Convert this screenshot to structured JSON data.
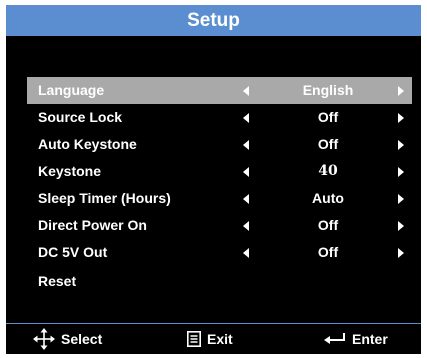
{
  "title": "Setup",
  "menu": [
    {
      "label": "Language",
      "value": "English",
      "selected": true
    },
    {
      "label": "Source Lock",
      "value": "Off"
    },
    {
      "label": "Auto Keystone",
      "value": "Off"
    },
    {
      "label": "Keystone",
      "value": "40"
    },
    {
      "label": "Sleep Timer (Hours)",
      "value": "Auto"
    },
    {
      "label": "Direct Power On",
      "value": "Off"
    },
    {
      "label": "DC 5V Out",
      "value": "Off"
    },
    {
      "label": "Reset",
      "value": ""
    }
  ],
  "footer": {
    "select": {
      "label": "Select",
      "icon": "four-way-arrows-icon"
    },
    "exit": {
      "label": "Exit",
      "icon": "menu-icon"
    },
    "enter": {
      "label": "Enter",
      "icon": "enter-arrow-icon"
    }
  },
  "colors": {
    "title_bar": "#5b8ed0",
    "selected_row": "#a9a9a9",
    "background": "#000000"
  }
}
